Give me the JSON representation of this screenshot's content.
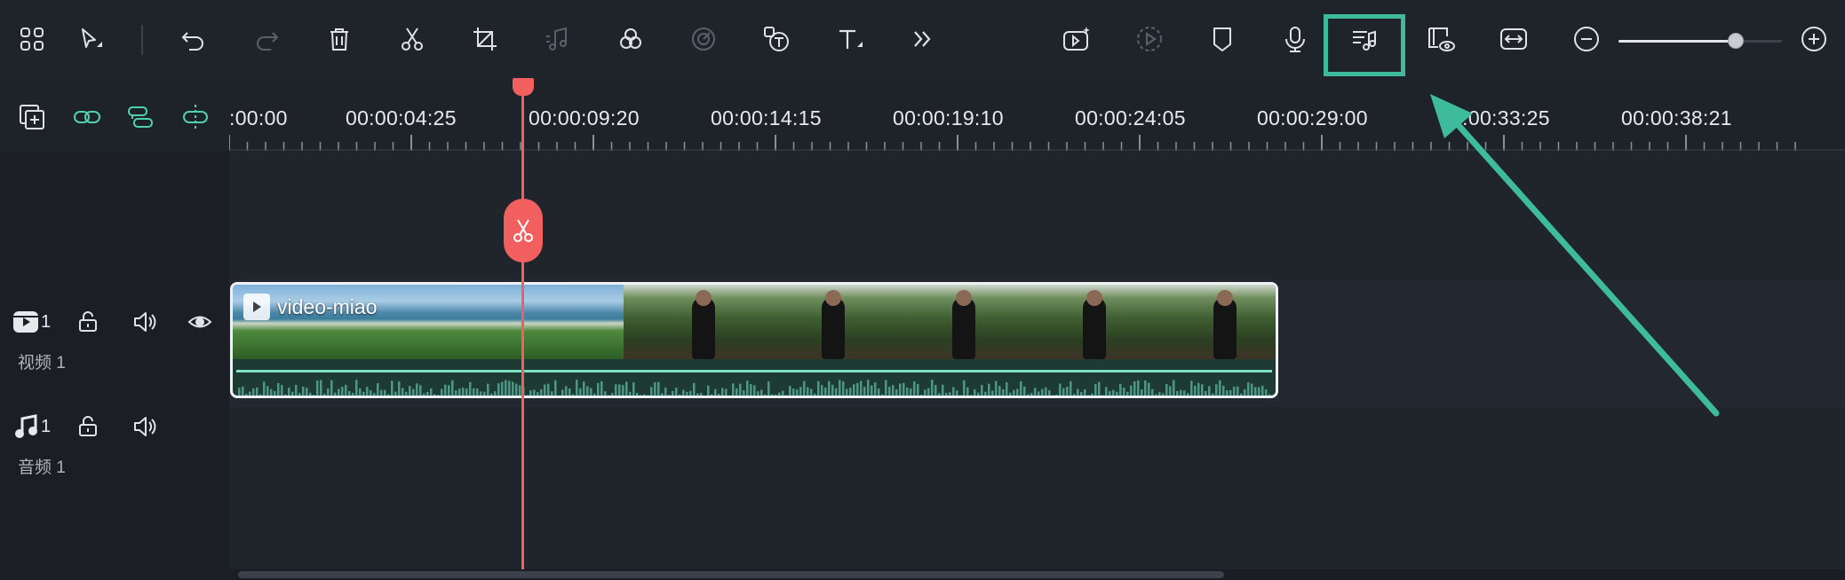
{
  "toolbar": {
    "icons": [
      "apps-grid-icon",
      "select-pointer-icon",
      "undo-icon",
      "redo-icon",
      "delete-icon",
      "cut-icon",
      "crop-icon",
      "audio-detach-icon",
      "color-icon",
      "speed-icon",
      "text-to-speech-icon",
      "text-icon",
      "more-icon",
      "ai-clip-icon",
      "render-preview-icon",
      "marker-icon",
      "voiceover-mic-icon",
      "beat-sync-music-icon",
      "render-eye-icon",
      "fit-timeline-icon",
      "zoom-out-icon",
      "zoom-in-icon"
    ],
    "zoom_level": 0.72,
    "highlight_color": "#3ebb9d"
  },
  "ruler": {
    "labels": [
      ":00:00",
      "00:00:04:25",
      "00:00:09:20",
      "00:00:14:15",
      "00:00:19:10",
      "00:00:24:05",
      "00:00:29:00",
      "00:00:33:25",
      "00:00:38:21"
    ]
  },
  "tracks": {
    "video": {
      "number": "1",
      "name": "视频 1"
    },
    "audio": {
      "number": "1",
      "name": "音频 1"
    }
  },
  "clip": {
    "title": "video-miao",
    "accent": "#7fe0c6"
  },
  "colors": {
    "playhead": "#f25f5f",
    "arrow": "#3ebb9d"
  }
}
